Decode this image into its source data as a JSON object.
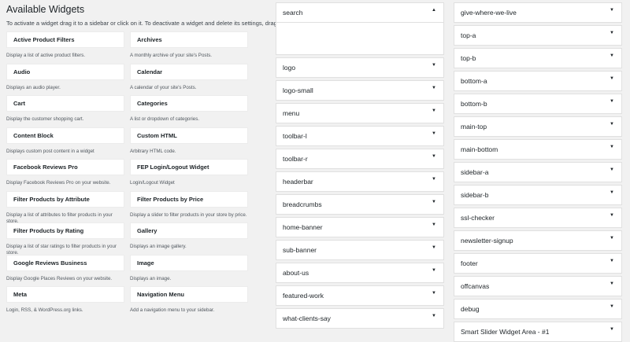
{
  "available": {
    "title": "Available Widgets",
    "help": "To activate a widget drag it to a sidebar or click on it. To deactivate a widget and delete its settings, drag it back.",
    "rows": [
      [
        {
          "name": "Active Product Filters",
          "desc": "Display a list of active product filters."
        },
        {
          "name": "Archives",
          "desc": "A monthly archive of your site's Posts."
        }
      ],
      [
        {
          "name": "Audio",
          "desc": "Displays an audio player."
        },
        {
          "name": "Calendar",
          "desc": "A calendar of your site's Posts."
        }
      ],
      [
        {
          "name": "Cart",
          "desc": "Display the customer shopping cart."
        },
        {
          "name": "Categories",
          "desc": "A list or dropdown of categories."
        }
      ],
      [
        {
          "name": "Content Block",
          "desc": "Displays custom post content in a widget"
        },
        {
          "name": "Custom HTML",
          "desc": "Arbitrary HTML code."
        }
      ],
      [
        {
          "name": "Facebook Reviews Pro",
          "desc": "Display Facebook Reviews Pro on your website."
        },
        {
          "name": "FEP Login/Logout Widget",
          "desc": "Login/Logout Widget"
        }
      ],
      [
        {
          "name": "Filter Products by Attribute",
          "desc": "Display a list of attributes to filter products in your store."
        },
        {
          "name": "Filter Products by Price",
          "desc": "Display a slider to filter products in your store by price."
        }
      ],
      [
        {
          "name": "Filter Products by Rating",
          "desc": "Display a list of star ratings to filter products in your store."
        },
        {
          "name": "Gallery",
          "desc": "Displays an image gallery."
        }
      ],
      [
        {
          "name": "Google Reviews Business",
          "desc": "Display Google Places Reviews on your website."
        },
        {
          "name": "Image",
          "desc": "Displays an image."
        }
      ],
      [
        {
          "name": "Meta",
          "desc": "Login, RSS, & WordPress.org links."
        },
        {
          "name": "Navigation Menu",
          "desc": "Add a navigation menu to your sidebar."
        }
      ]
    ]
  },
  "sidebars_mid": [
    "search",
    "logo",
    "logo-small",
    "menu",
    "toolbar-l",
    "toolbar-r",
    "headerbar",
    "breadcrumbs",
    "home-banner",
    "sub-banner",
    "about-us",
    "featured-work",
    "what-clients-say"
  ],
  "sidebars_right": [
    "give-where-we-live",
    "top-a",
    "top-b",
    "bottom-a",
    "bottom-b",
    "main-top",
    "main-bottom",
    "sidebar-a",
    "sidebar-b",
    "ssl-checker",
    "newsletter-signup",
    "footer",
    "offcanvas",
    "debug",
    "Smart Slider Widget Area - #1"
  ],
  "icons": {
    "toggle": "caret-down-icon",
    "toggle_up": "caret-up-icon"
  }
}
